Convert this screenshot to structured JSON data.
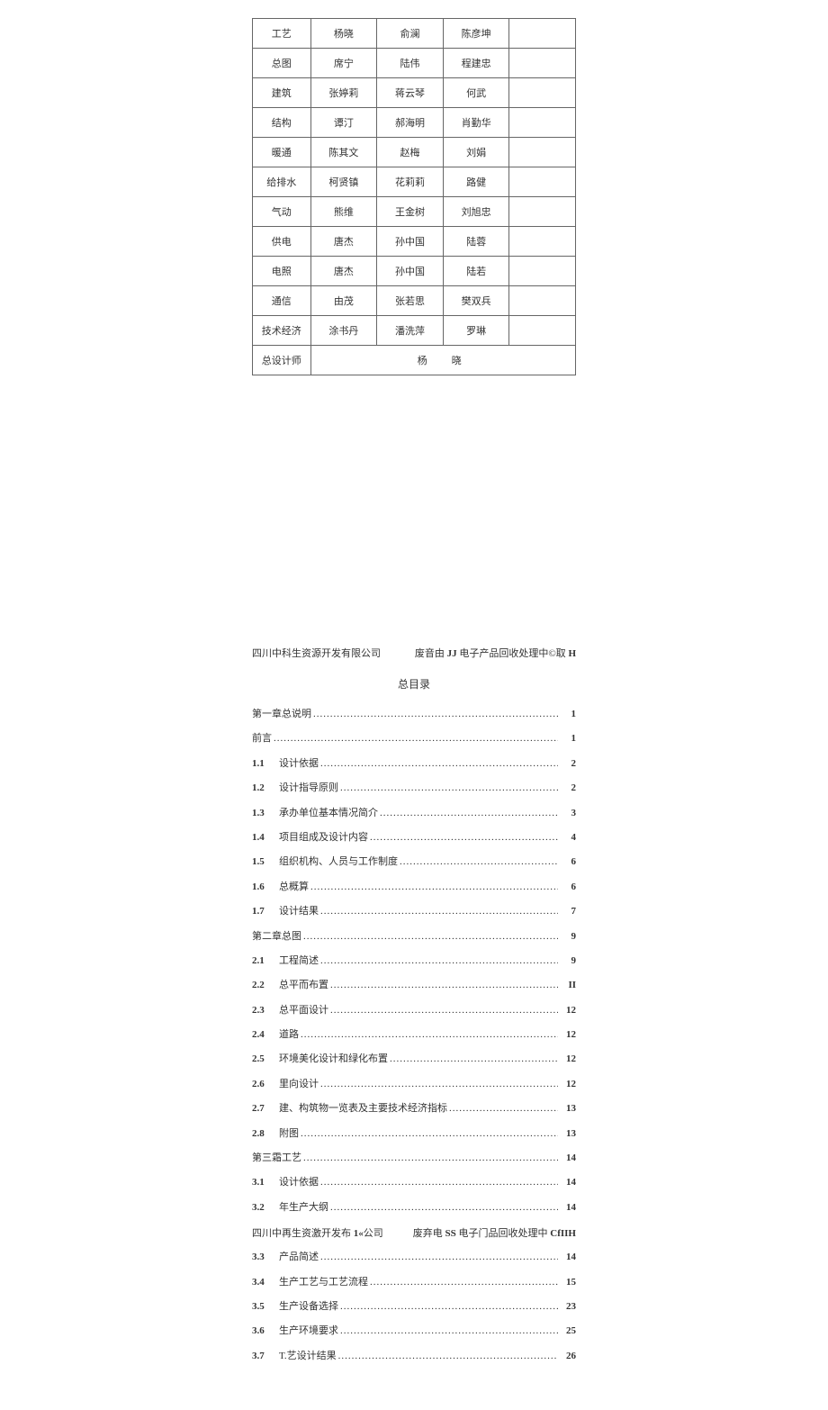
{
  "staff_table": {
    "rows": [
      {
        "c0": "工艺",
        "c1": "杨晓",
        "c2": "俞澜",
        "c3": "陈彦坤",
        "c4": ""
      },
      {
        "c0": "总图",
        "c1": "席宁",
        "c2": "陆伟",
        "c3": "程建忠",
        "c4": ""
      },
      {
        "c0": "建筑",
        "c1": "张婷莉",
        "c2": "蒋云琴",
        "c3": "何武",
        "c4": ""
      },
      {
        "c0": "结构",
        "c1": "谭汀",
        "c2": "郝海明",
        "c3": "肖勤华",
        "c4": ""
      },
      {
        "c0": "暖通",
        "c1": "陈其文",
        "c2": "赵梅",
        "c3": "刘娟",
        "c4": ""
      },
      {
        "c0": "给排水",
        "c1": "柯贤镇",
        "c2": "花莉莉",
        "c3": "路健",
        "c4": ""
      },
      {
        "c0": "气动",
        "c1": "熊维",
        "c2": "王金树",
        "c3": "刘旭忠",
        "c4": ""
      },
      {
        "c0": "供电",
        "c1": "唐杰",
        "c2": "孙中国",
        "c3": "陆蓉",
        "c4": ""
      },
      {
        "c0": "电照",
        "c1": "唐杰",
        "c2": "孙中国",
        "c3": "陆若",
        "c4": ""
      },
      {
        "c0": "通信",
        "c1": "由茂",
        "c2": "张若思",
        "c3": "樊双兵",
        "c4": ""
      },
      {
        "c0": "技术经济",
        "c1": "涂书丹",
        "c2": "潘洗萍",
        "c3": "罗琳",
        "c4": ""
      }
    ],
    "designer_row": {
      "c0": "总设计师",
      "merged": "杨　晓"
    }
  },
  "header1": {
    "left": "四川中科生资源开发有限公司",
    "right_prefix": "废音由 ",
    "right_bold1": "JJ",
    "right_mid": " 电子产品回收处理中©取 ",
    "right_bold2": "H"
  },
  "toc_title": "总目录",
  "toc": [
    {
      "type": "chapter",
      "num": "",
      "label": "第一章总说明",
      "page": "1"
    },
    {
      "type": "chapter",
      "num": "",
      "label": "前言",
      "page": "1"
    },
    {
      "type": "item",
      "num": "1.1",
      "label": "设计依据",
      "page": "2"
    },
    {
      "type": "item",
      "num": "1.2",
      "label": "设计指导原则",
      "page": "2"
    },
    {
      "type": "item",
      "num": "1.3",
      "label": "承办单位基本情况简介",
      "page": "3"
    },
    {
      "type": "item",
      "num": "1.4",
      "label": "项目组成及设计内容",
      "page": "4"
    },
    {
      "type": "item",
      "num": "1.5",
      "label": "组织机构、人员与工作制度",
      "page": "6"
    },
    {
      "type": "item",
      "num": "1.6",
      "label": "总概算",
      "page": "6"
    },
    {
      "type": "item",
      "num": "1.7",
      "label": "设计结果",
      "page": "7"
    },
    {
      "type": "chapter",
      "num": "",
      "label": "第二章总图",
      "page": "9"
    },
    {
      "type": "item",
      "num": "2.1",
      "label": "工程简述",
      "page": "9"
    },
    {
      "type": "item",
      "num": "2.2",
      "label": "总平而布置",
      "page": "II"
    },
    {
      "type": "item",
      "num": "2.3",
      "label": "总平面设计",
      "page": "12"
    },
    {
      "type": "item",
      "num": "2.4",
      "label": "道路",
      "page": "12"
    },
    {
      "type": "item",
      "num": "2.5",
      "label": "环境美化设计和绿化布置",
      "page": "12"
    },
    {
      "type": "item",
      "num": "2.6",
      "label": "里向设计",
      "page": "12"
    },
    {
      "type": "item",
      "num": "2.7",
      "label": "建、构筑物一览表及主要技术经济指标",
      "page": "13"
    },
    {
      "type": "item",
      "num": "2.8",
      "label": "附图",
      "page": "13"
    },
    {
      "type": "chapter",
      "num": "",
      "label": "第三霜工艺",
      "page": "14"
    },
    {
      "type": "item",
      "num": "3.1",
      "label": "设计依据",
      "page": "14"
    },
    {
      "type": "item",
      "num": "3.2",
      "label": "年生产大纲",
      "page": "14"
    }
  ],
  "header2": {
    "left_a": "四川中再生资激开发布 ",
    "left_b": "1«",
    "left_c": "公司",
    "right_a": "废弃电 ",
    "right_b": "SS",
    "right_c": " 电子门品回收处理中 ",
    "right_d": "CfIIH"
  },
  "toc2": [
    {
      "type": "item",
      "num": "3.3",
      "label": "产品简述",
      "page": "14"
    },
    {
      "type": "item",
      "num": "3.4",
      "label": "生产工艺与工艺流程",
      "page": "15"
    },
    {
      "type": "item",
      "num": "3.5",
      "label": "生产设备选择",
      "page": "23"
    },
    {
      "type": "item",
      "num": "3.6",
      "label": "生产环境要求",
      "page": "25"
    },
    {
      "type": "item",
      "num": "3.7",
      "label": "T.艺设计结果",
      "page": "26"
    }
  ],
  "dots": "........................................................................................................................"
}
